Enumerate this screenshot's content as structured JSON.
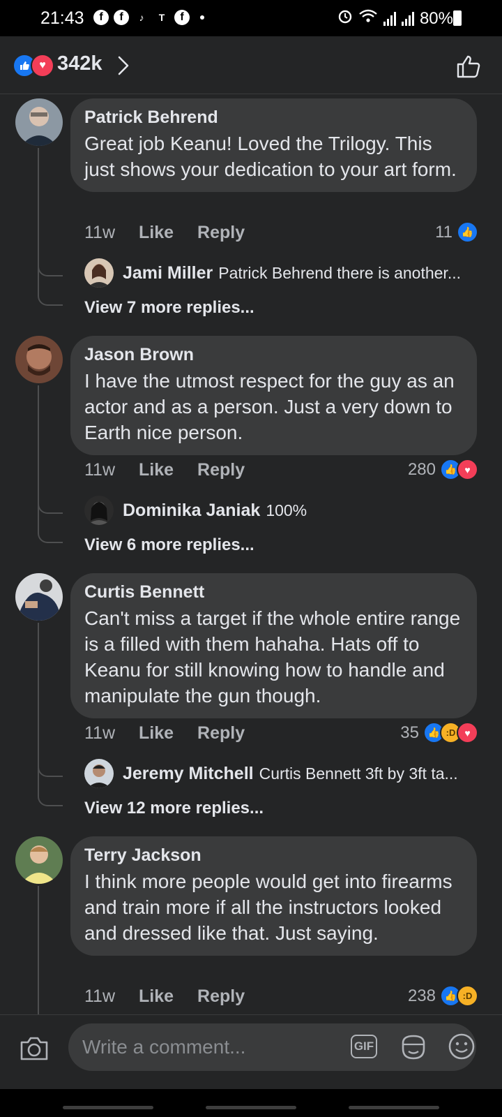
{
  "status": {
    "time": "21:43",
    "battery": "80%",
    "app_icons": [
      "facebook-icon",
      "facebook-icon",
      "tiktok-icon",
      "teams-icon",
      "facebook-icon"
    ]
  },
  "header": {
    "reaction_count": "342k",
    "reaction_icons": [
      "like",
      "love"
    ]
  },
  "comments": [
    {
      "author": "Patrick Behrend",
      "text": "Great job Keanu! Loved the Trilogy. This just shows your dedication to your art form.",
      "time": "11w",
      "like_label": "Like",
      "reply_label": "Reply",
      "reaction_count": "11",
      "reactions": [
        "like"
      ],
      "reply": {
        "author": "Jami Miller",
        "text": "Patrick Behrend there is another..."
      },
      "view_more": "View 7 more replies...",
      "avatar_color": "#9aa4ad"
    },
    {
      "author": "Jason Brown",
      "text": "I have the utmost respect for the guy as an actor and as a person. Just a very down to Earth nice person.",
      "time": "11w",
      "like_label": "Like",
      "reply_label": "Reply",
      "reaction_count": "280",
      "reactions": [
        "like",
        "love"
      ],
      "reply": {
        "author": "Dominika Janiak",
        "text": "100%"
      },
      "view_more": "View 6 more replies...",
      "avatar_color": "#8a5a44"
    },
    {
      "author": "Curtis Bennett",
      "text": "Can't miss a target if the whole entire range is a filled with them hahaha. Hats off to Keanu for still knowing how to handle and manipulate the gun though.",
      "time": "11w",
      "like_label": "Like",
      "reply_label": "Reply",
      "reaction_count": "35",
      "reactions": [
        "like",
        "haha",
        "love"
      ],
      "reply": {
        "author": "Jeremy Mitchell",
        "text": "Curtis Bennett 3ft by 3ft ta..."
      },
      "view_more": "View 12 more replies...",
      "avatar_color": "#3b4a66"
    },
    {
      "author": "Terry Jackson",
      "text": "I think more people would get into firearms and train more if all the instructors looked and dressed like that. Just saying.",
      "time": "11w",
      "like_label": "Like",
      "reply_label": "Reply",
      "reaction_count": "238",
      "reactions": [
        "like",
        "haha"
      ],
      "avatar_color": "#6f8a55"
    }
  ],
  "composer": {
    "placeholder": "Write a comment...",
    "gif_label": "GIF"
  },
  "colors": {
    "background": "#242526",
    "bubble": "#3a3b3c",
    "like_blue": "#1877f2",
    "love_red": "#f33e58",
    "haha_yellow": "#f7b125"
  }
}
